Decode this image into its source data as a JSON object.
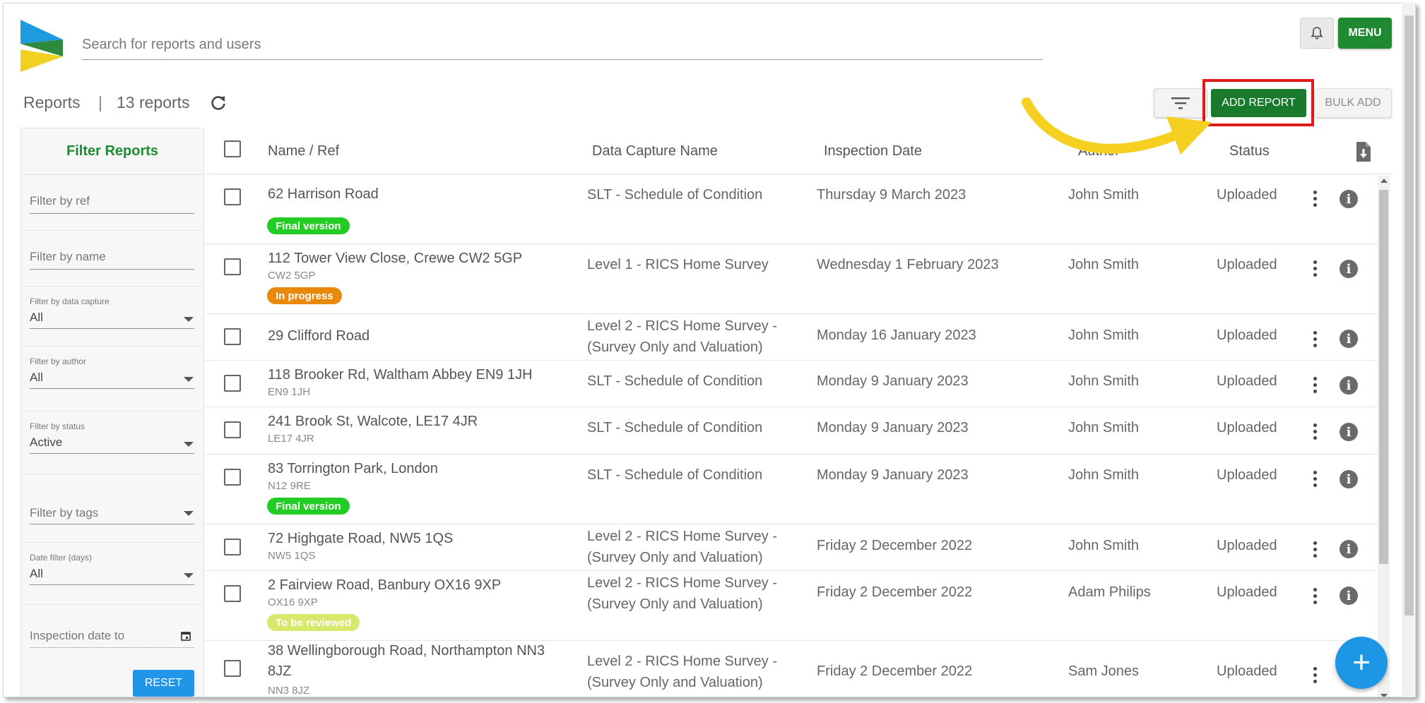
{
  "search": {
    "placeholder": "Search for reports and users"
  },
  "header": {
    "menu_label": "MENU",
    "bell_icon": "bell-icon"
  },
  "reports": {
    "title": "Reports",
    "separator": "|",
    "count": "13 reports"
  },
  "toolbar": {
    "add_report": "ADD REPORT",
    "bulk_add": "BULK ADD"
  },
  "sidebar": {
    "title": "Filter Reports",
    "ref_placeholder": "Filter by ref",
    "name_placeholder": "Filter by name",
    "data_capture_label": "Filter by data capture",
    "data_capture_value": "All",
    "author_label": "Filter by author",
    "author_value": "All",
    "status_label": "Filter by status",
    "status_value": "Active",
    "tags_placeholder": "Filter by tags",
    "date_label": "Date filter (days)",
    "date_value": "All",
    "inspection_placeholder": "Inspection date to",
    "reset": "RESET"
  },
  "table": {
    "headers": {
      "name": "Name / Ref",
      "data_capture": "Data Capture Name",
      "inspection": "Inspection Date",
      "author": "Author",
      "status": "Status"
    },
    "rows": [
      {
        "name": "62 Harrison Road",
        "ref": "",
        "badge": "Final version",
        "data_capture": "SLT - Schedule of Condition",
        "date": "Thursday 9 March 2023",
        "author": "John Smith",
        "status": "Uploaded"
      },
      {
        "name": "112 Tower View Close, Crewe CW2 5GP",
        "ref": "CW2 5GP",
        "badge": "In progress",
        "data_capture": "Level 1 - RICS Home Survey",
        "date": "Wednesday 1 February 2023",
        "author": "John Smith",
        "status": "Uploaded"
      },
      {
        "name": "29 Clifford Road",
        "ref": "",
        "badge": "",
        "data_capture": "Level 2 - RICS Home Survey - (Survey Only and Valuation)",
        "date": "Monday 16 January 2023",
        "author": "John Smith",
        "status": "Uploaded"
      },
      {
        "name": "118 Brooker Rd, Waltham Abbey EN9 1JH",
        "ref": "EN9 1JH",
        "badge": "",
        "data_capture": "SLT - Schedule of Condition",
        "date": "Monday 9 January 2023",
        "author": "John Smith",
        "status": "Uploaded"
      },
      {
        "name": "241 Brook St, Walcote, LE17 4JR",
        "ref": "LE17 4JR",
        "badge": "",
        "data_capture": "SLT - Schedule of Condition",
        "date": "Monday 9 January 2023",
        "author": "John Smith",
        "status": "Uploaded"
      },
      {
        "name": "83 Torrington Park, London",
        "ref": "N12 9RE",
        "badge": "Final version",
        "data_capture": "SLT - Schedule of Condition",
        "date": "Monday 9 January 2023",
        "author": "John Smith",
        "status": "Uploaded"
      },
      {
        "name": "72 Highgate Road, NW5 1QS",
        "ref": "NW5 1QS",
        "badge": "",
        "data_capture": "Level 2 - RICS Home Survey - (Survey Only and Valuation)",
        "date": "Friday 2 December 2022",
        "author": "John Smith",
        "status": "Uploaded"
      },
      {
        "name": "2 Fairview Road, Banbury OX16 9XP",
        "ref": "OX16 9XP",
        "badge": "To be reviewed",
        "data_capture": "Level 2 - RICS Home Survey - (Survey Only and Valuation)",
        "date": "Friday 2 December 2022",
        "author": "Adam Philips",
        "status": "Uploaded"
      },
      {
        "name": "38 Wellingborough Road, Northampton NN3 8JZ",
        "ref": "NN3 8JZ",
        "badge": "",
        "data_capture": "Level 2 - RICS Home Survey - (Survey Only and Valuation)",
        "date": "Friday 2 December 2022",
        "author": "Sam Jones",
        "status": "Uploaded"
      }
    ]
  },
  "colors": {
    "brand_green": "#1f8a32",
    "final_version": "#22cc22",
    "in_progress": "#e8880c",
    "to_be_reviewed": "#d8e86a",
    "fab_blue": "#1e96e6",
    "highlight_red": "#e11b1b",
    "arrow_yellow": "#f5d020"
  },
  "fab": {
    "label": "+"
  }
}
